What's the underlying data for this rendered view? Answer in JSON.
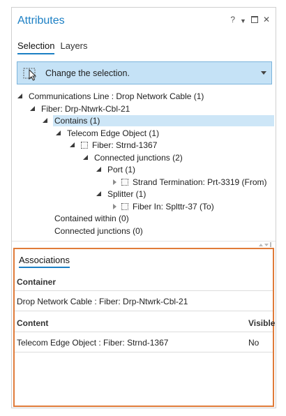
{
  "title": "Attributes",
  "title_controls": {
    "help": "?"
  },
  "tabs": [
    {
      "label": "Selection",
      "active": true
    },
    {
      "label": "Layers",
      "active": false
    }
  ],
  "selector": {
    "label": "Change the selection."
  },
  "tree": {
    "root": "Communications Line : Drop Network Cable (1)",
    "fiber": "Fiber: Drp-Ntwrk-Cbl-21",
    "contains": "Contains (1)",
    "telecom": "Telecom Edge Object (1)",
    "fiber_strnd": "Fiber: Strnd-1367",
    "connected_junctions": "Connected junctions (2)",
    "port": "Port (1)",
    "strand_termination": "Strand Termination: Prt-3319 (From)",
    "splitter": "Splitter (1)",
    "fiber_in": "Fiber In: Splttr-37 (To)",
    "contained_within": "Contained within (0)",
    "connected_junctions_0": "Connected junctions (0)"
  },
  "associations": {
    "heading": "Associations",
    "container_header": "Container",
    "container_value": "Drop Network Cable : Fiber: Drp-Ntwrk-Cbl-21",
    "content_header": "Content",
    "visible_header": "Visible",
    "content_value": "Telecom Edge Object : Fiber: Strnd-1367",
    "visible_value": "No"
  },
  "colors": {
    "accent": "#1b7fc4",
    "selector_bg": "#c5e2f6",
    "highlight_border": "#e07b39"
  }
}
